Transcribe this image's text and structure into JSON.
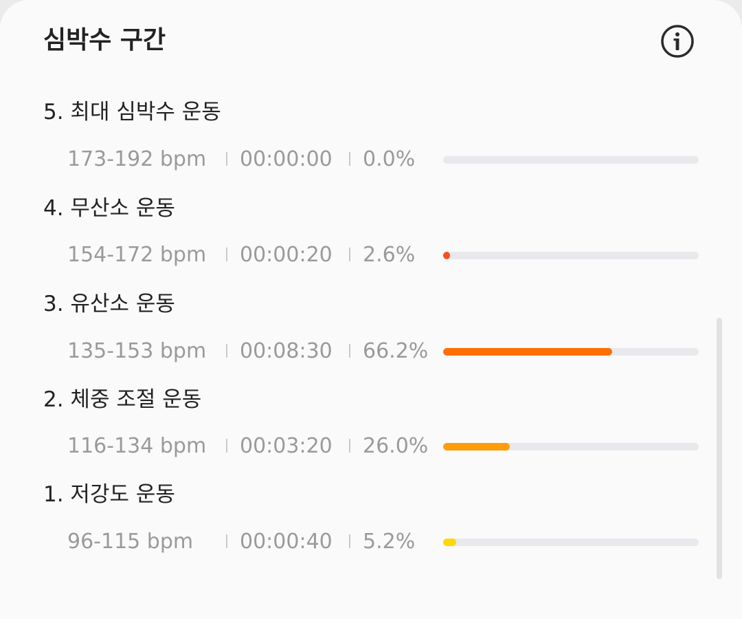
{
  "header": {
    "title": "심박수 구간"
  },
  "zones": [
    {
      "title": "5. 최대 심박수 운동",
      "range": "173-192 bpm",
      "time": "00:00:00",
      "percent": "0.0%",
      "fraction": 0.0,
      "color": "#ff4a1a"
    },
    {
      "title": "4. 무산소 운동",
      "range": "154-172 bpm",
      "time": "00:00:20",
      "percent": "2.6%",
      "fraction": 0.026,
      "color": "#f4511e"
    },
    {
      "title": "3. 유산소 운동",
      "range": "135-153 bpm",
      "time": "00:08:30",
      "percent": "66.2%",
      "fraction": 0.662,
      "color": "#ff6f00"
    },
    {
      "title": "2. 체중 조절 운동",
      "range": "116-134 bpm",
      "time": "00:03:20",
      "percent": "26.0%",
      "fraction": 0.26,
      "color": "#ff9d0a"
    },
    {
      "title": "1. 저강도 운동",
      "range": "96-115 bpm",
      "time": "00:00:40",
      "percent": "5.2%",
      "fraction": 0.052,
      "color": "#ffd60a"
    }
  ]
}
